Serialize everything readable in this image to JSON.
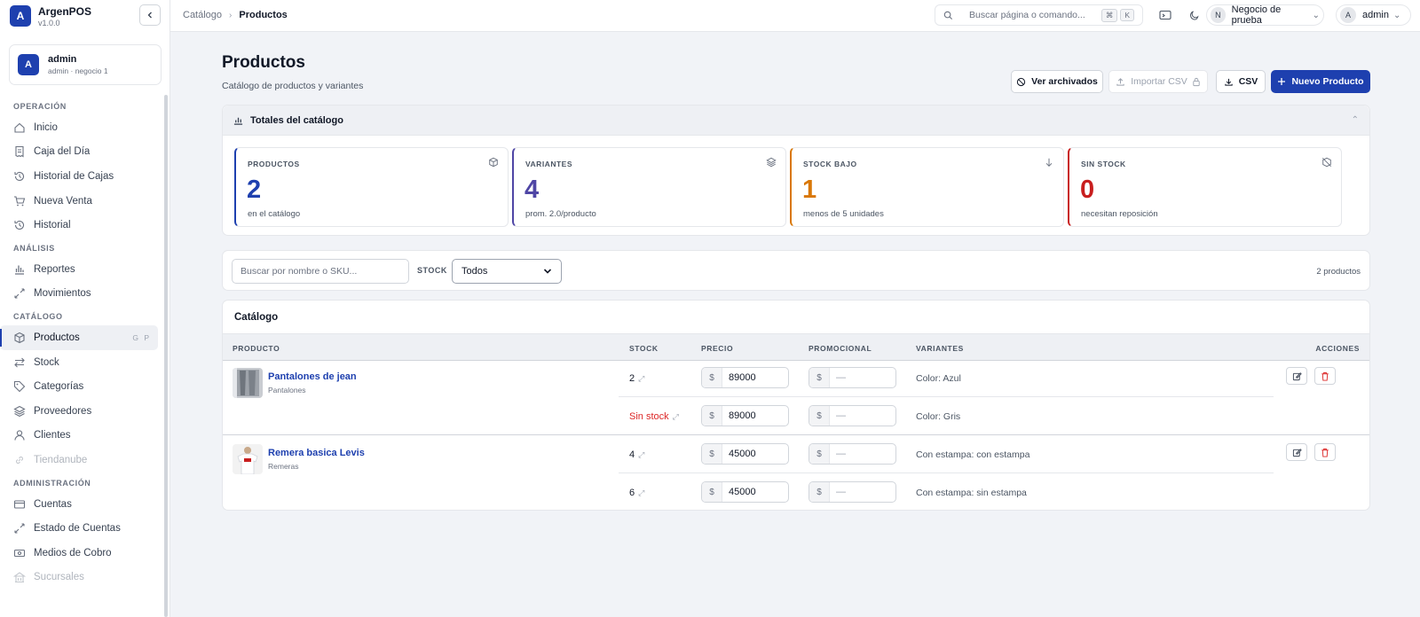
{
  "app": {
    "logo_letter": "A",
    "name": "ArgenPOS",
    "version": "v1.0.0"
  },
  "user": {
    "initial": "A",
    "name": "admin",
    "subtitle": "admin · negocio 1"
  },
  "nav": {
    "sections": [
      {
        "title": "OPERACIÓN",
        "items": [
          {
            "label": "Inicio",
            "icon": "home-icon"
          },
          {
            "label": "Caja del Día",
            "icon": "receipt-icon"
          },
          {
            "label": "Historial de Cajas",
            "icon": "history-icon"
          },
          {
            "label": "Nueva Venta",
            "icon": "cart-icon"
          },
          {
            "label": "Historial",
            "icon": "history-icon"
          }
        ]
      },
      {
        "title": "ANÁLISIS",
        "items": [
          {
            "label": "Reportes",
            "icon": "bar-chart-icon"
          },
          {
            "label": "Movimientos",
            "icon": "arrows-icon"
          }
        ]
      },
      {
        "title": "CATÁLOGO",
        "items": [
          {
            "label": "Productos",
            "icon": "box-icon",
            "active": true,
            "shortcut": "G P"
          },
          {
            "label": "Stock",
            "icon": "swap-icon"
          },
          {
            "label": "Categorías",
            "icon": "tag-icon"
          },
          {
            "label": "Proveedores",
            "icon": "layers-icon"
          },
          {
            "label": "Clientes",
            "icon": "user-icon"
          },
          {
            "label": "Tiendanube",
            "icon": "link-icon",
            "disabled": true
          }
        ]
      },
      {
        "title": "ADMINISTRACIÓN",
        "items": [
          {
            "label": "Cuentas",
            "icon": "card-icon"
          },
          {
            "label": "Estado de Cuentas",
            "icon": "arrows-icon"
          },
          {
            "label": "Medios de Cobro",
            "icon": "money-icon"
          },
          {
            "label": "Sucursales",
            "icon": "building-icon",
            "disabled": true
          }
        ]
      }
    ]
  },
  "breadcrumb": {
    "parent": "Catálogo",
    "current": "Productos"
  },
  "topbar": {
    "search_placeholder": "Buscar página o comando...",
    "kbd_cmd": "⌘",
    "kbd_key": "K",
    "business_initial": "N",
    "business_name": "Negocio de prueba",
    "account_initial": "A",
    "account_name": "admin"
  },
  "page": {
    "title": "Productos",
    "subtitle": "Catálogo de productos y variantes",
    "buttons": {
      "archived": "Ver archivados",
      "import_csv": "Importar CSV",
      "csv": "CSV",
      "new_product": "Nuevo Producto"
    }
  },
  "totals": {
    "title": "Totales del catálogo",
    "cards": [
      {
        "label": "PRODUCTOS",
        "value": "2",
        "sub": "en el catálogo",
        "color": "#1e40af",
        "icon": "box-icon"
      },
      {
        "label": "VARIANTES",
        "value": "4",
        "sub": "prom. 2.0/producto",
        "color": "#4f46a5",
        "icon": "layers-icon"
      },
      {
        "label": "STOCK BAJO",
        "value": "1",
        "sub": "menos de 5 unidades",
        "color": "#d97706",
        "icon": "arrow-down-icon"
      },
      {
        "label": "SIN STOCK",
        "value": "0",
        "sub": "necesitan reposición",
        "color": "#c81e1e",
        "icon": "no-stock-icon"
      }
    ]
  },
  "filters": {
    "search_placeholder": "Buscar por nombre o SKU...",
    "stock_label": "STOCK",
    "stock_value": "Todos",
    "count": "2 productos"
  },
  "catalog": {
    "title": "Catálogo",
    "columns": [
      "PRODUCTO",
      "STOCK",
      "PRECIO",
      "PROMOCIONAL",
      "VARIANTES",
      "ACCIONES"
    ],
    "currency": "$",
    "empty_promo": "—",
    "products": [
      {
        "name": "Pantalones de jean",
        "category": "Pantalones",
        "variants": [
          {
            "stock": "2",
            "price": "89000",
            "variant": "Color: Azul"
          },
          {
            "stock": "Sin stock",
            "price": "89000",
            "variant": "Color: Gris",
            "out": true
          }
        ]
      },
      {
        "name": "Remera basica Levis",
        "category": "Remeras",
        "variants": [
          {
            "stock": "4",
            "price": "45000",
            "variant": "Con estampa: con estampa"
          },
          {
            "stock": "6",
            "price": "45000",
            "variant": "Con estampa: sin estampa"
          }
        ]
      }
    ]
  }
}
